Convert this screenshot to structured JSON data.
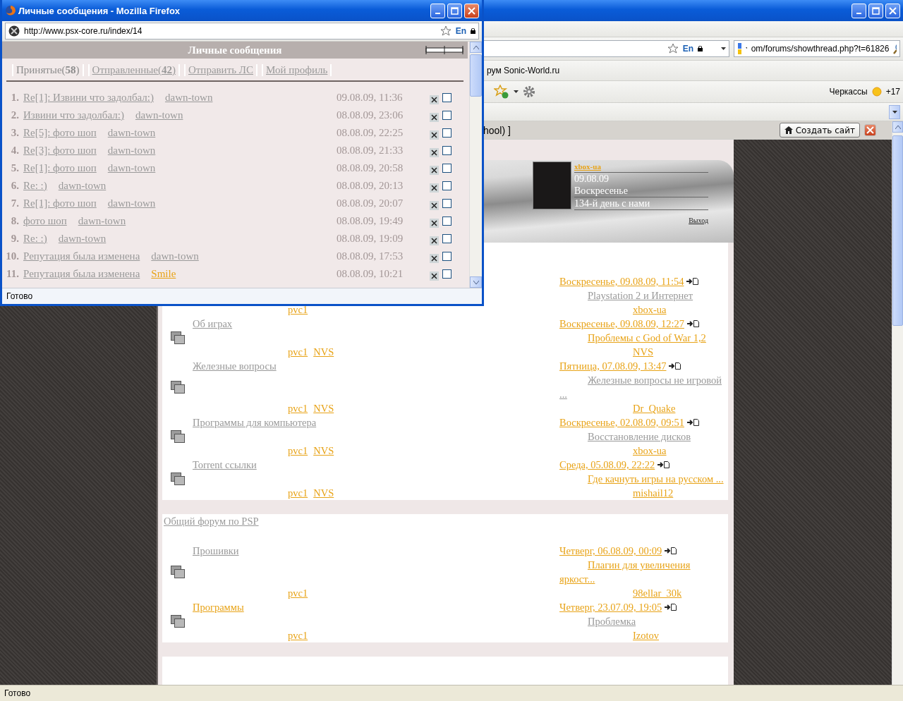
{
  "main_window": {
    "search_field": {
      "value": "om/forums/showthread.php?t=61826"
    },
    "bookmarks": [
      "рум Sonic-World.ru"
    ],
    "weather": {
      "city": "Черкассы",
      "temperature": "+17"
    },
    "notification_bar": {
      "text": "hool) ]",
      "button": "Создать сайт"
    },
    "page": {
      "profile": {
        "username": "xbox-ua",
        "date": "09.08.09",
        "weekday": "Воскресенье",
        "days": "134-й день с нами",
        "logout": "Выход"
      },
      "sections": [
        {
          "rows": [
            {
              "moderators": [
                {
                  "text": "pvc1",
                  "visited": false
                }
              ],
              "last_post": {
                "date": {
                  "text": "Воскресенье, 09.08.09, 11:54",
                  "visited": false
                },
                "topic": {
                  "text": "Playstation 2 и Интернет",
                  "visited": true
                },
                "author": {
                  "text": "xbox-ua",
                  "visited": false
                }
              }
            },
            {
              "title": {
                "text": "Об играх",
                "visited": true
              },
              "moderators": [
                {
                  "text": "pvc1",
                  "visited": false
                },
                {
                  "text": "NVS",
                  "visited": false
                }
              ],
              "last_post": {
                "date": {
                  "text": "Воскресенье, 09.08.09, 12:27",
                  "visited": false
                },
                "topic": {
                  "text": "Проблемы с God of War 1,2",
                  "visited": false
                },
                "author": {
                  "text": "NVS",
                  "visited": false
                }
              }
            },
            {
              "title": {
                "text": "Железные вопросы",
                "visited": true
              },
              "moderators": [
                {
                  "text": "pvc1",
                  "visited": false
                },
                {
                  "text": "NVS",
                  "visited": false
                }
              ],
              "last_post": {
                "date": {
                  "text": "Пятница, 07.08.09, 13:47",
                  "visited": false
                },
                "topic": {
                  "text": "Железные вопросы не игровой ...",
                  "visited": true
                },
                "author": {
                  "text": "Dr_Quake",
                  "visited": false
                }
              }
            },
            {
              "title": {
                "text": "Программы для компьютера",
                "visited": true
              },
              "moderators": [
                {
                  "text": "pvc1",
                  "visited": false
                },
                {
                  "text": "NVS",
                  "visited": false
                }
              ],
              "last_post": {
                "date": {
                  "text": "Воскресенье, 02.08.09, 09:51",
                  "visited": false
                },
                "topic": {
                  "text": "Восстановление дисков",
                  "visited": true
                },
                "author": {
                  "text": "xbox-ua",
                  "visited": false
                }
              }
            },
            {
              "title": {
                "text": "Torrent ссылки",
                "visited": true
              },
              "moderators": [
                {
                  "text": "pvc1",
                  "visited": false
                },
                {
                  "text": "NVS",
                  "visited": false
                }
              ],
              "last_post": {
                "date": {
                  "text": "Среда, 05.08.09, 22:22",
                  "visited": false
                },
                "topic": {
                  "text": "Где качнуть игры на русском ...",
                  "visited": false
                },
                "author": {
                  "text": "mishail12",
                  "visited": false
                }
              }
            }
          ]
        },
        {
          "title": {
            "text": "Общий форум по PSP",
            "visited": true
          },
          "rows": [
            {
              "title": {
                "text": "Прошивки",
                "visited": true
              },
              "moderators": [
                {
                  "text": "pvc1",
                  "visited": false
                }
              ],
              "last_post": {
                "date": {
                  "text": "Четверг, 06.08.09, 00:09",
                  "visited": false
                },
                "topic": {
                  "text": "Плагин для увеличения яркост...",
                  "visited": false
                },
                "author": {
                  "text": "98ellar_30k",
                  "visited": false
                }
              }
            },
            {
              "title": {
                "text": "Программы",
                "visited": false
              },
              "moderators": [
                {
                  "text": "pvc1",
                  "visited": false
                }
              ],
              "last_post": {
                "date": {
                  "text": "Четверг, 23.07.09, 19:05",
                  "visited": false
                },
                "topic": {
                  "text": "Проблемка",
                  "visited": true
                },
                "author": {
                  "text": "Izotov",
                  "visited": false
                }
              }
            }
          ]
        }
      ]
    },
    "url_locale": "En",
    "status_bar": "Готово"
  },
  "popup": {
    "title": "Личные сообщения - Mozilla Firefox",
    "url": "http://www.psx-core.ru/index/14",
    "url_locale": "En",
    "heading": "Личные сообщения",
    "tabs": [
      {
        "label": "Принятые(**58**)",
        "selected": true
      },
      {
        "label": "Отправленные(**42**)",
        "selected": false
      },
      {
        "label": "Отправить ЛС",
        "selected": false
      },
      {
        "label": "Мой профиль",
        "selected": false
      }
    ],
    "messages": [
      {
        "number": "1.",
        "subject": "Re[1]: Извини что задолбал:)",
        "author": "dawn-town",
        "color": "#9a9a9a",
        "date": "09.08.09, 11:36",
        "checked": false
      },
      {
        "number": "2.",
        "subject": "Извини что задолбал:)",
        "author": "dawn-town",
        "color": "#9a9a9a",
        "date": "08.08.09, 23:06",
        "checked": false
      },
      {
        "number": "3.",
        "subject": "Re[5]: фото шоп",
        "author": "dawn-town",
        "color": "#9a9a9a",
        "date": "08.08.09, 22:25",
        "checked": false
      },
      {
        "number": "4.",
        "subject": "Re[3]: фото шоп",
        "author": "dawn-town",
        "color": "#9a9a9a",
        "date": "08.08.09, 21:33",
        "checked": false
      },
      {
        "number": "5.",
        "subject": "Re[1]: фото шоп",
        "author": "dawn-town",
        "color": "#9a9a9a",
        "date": "08.08.09, 20:58",
        "checked": false
      },
      {
        "number": "6.",
        "subject": "Re: :)",
        "author": "dawn-town",
        "color": "#9a9a9a",
        "date": "08.08.09, 20:13",
        "checked": false
      },
      {
        "number": "7.",
        "subject": "Re[1]: фото шоп",
        "author": "dawn-town",
        "color": "#9a9a9a",
        "date": "08.08.09, 20:07",
        "checked": false
      },
      {
        "number": "8.",
        "subject": "фото шоп",
        "author": "dawn-town",
        "color": "#9a9a9a",
        "date": "08.08.09, 19:49",
        "checked": false
      },
      {
        "number": "9.",
        "subject": "Re: :)",
        "author": "dawn-town",
        "color": "#9a9a9a",
        "date": "08.08.09, 19:09",
        "checked": false
      },
      {
        "number": "10.",
        "subject": "Репутация была изменена",
        "author": "dawn-town",
        "color": "#9a9a9a",
        "date": "08.08.09, 17:53",
        "checked": false
      },
      {
        "number": "11.",
        "subject": "Репутация была изменена",
        "author": "Smile",
        "color": "#e8a317",
        "date": "08.08.09, 10:21",
        "checked": false
      }
    ],
    "status_bar": "Готово"
  }
}
